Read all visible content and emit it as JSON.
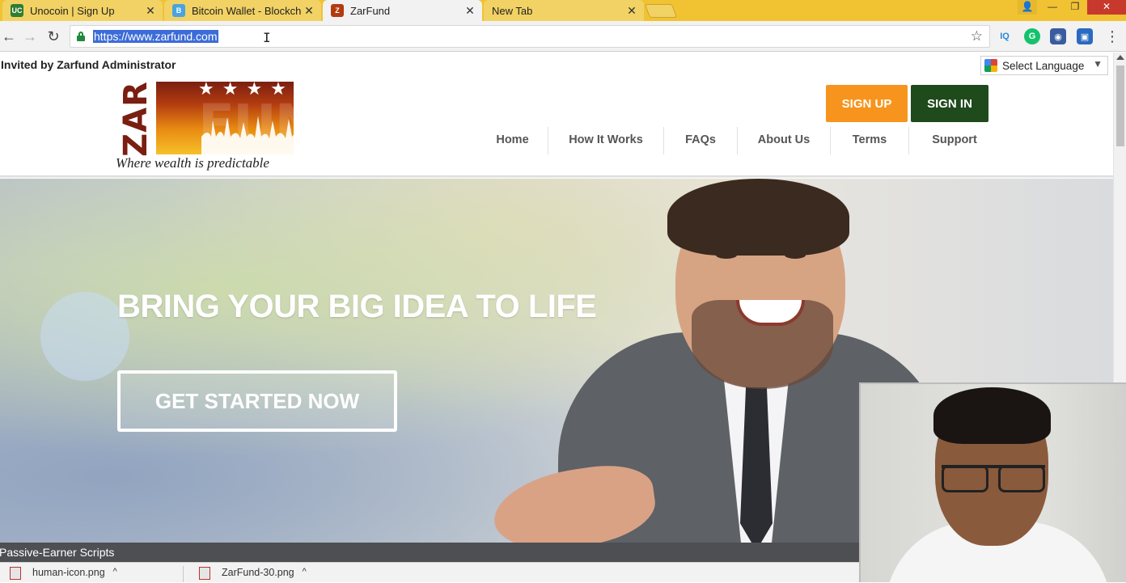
{
  "tabs": [
    {
      "label": "Unocoin | Sign Up",
      "favicon_text": "UC",
      "favicon_color": "#2e7d32",
      "close": "✕"
    },
    {
      "label": "Bitcoin Wallet - Blockcha",
      "favicon_text": "B",
      "favicon_color": "#4aa3df",
      "close": "✕"
    },
    {
      "label": "ZarFund",
      "favicon_text": "Z",
      "favicon_color": "#b23b10",
      "close": "✕"
    },
    {
      "label": "New Tab",
      "favicon_text": "",
      "favicon_color": "",
      "close": "✕"
    }
  ],
  "window_controls": {
    "minimize": "—",
    "maximize": "❐",
    "close": "✕",
    "profile": "👤"
  },
  "toolbar": {
    "back": "←",
    "forward": "→",
    "reload": "↻",
    "url": "https://www.zarfund.com",
    "star": "☆",
    "extensions": [
      {
        "name": "iq-extension-icon",
        "text": "IQ",
        "color": "#2a86d8"
      },
      {
        "name": "grammarly-icon",
        "text": "G",
        "color": "#15c26b"
      },
      {
        "name": "user-ext-icon",
        "text": "◉",
        "color": "#3a5ba0"
      },
      {
        "name": "save-ext-icon",
        "text": "▣",
        "color": "#2a6ac0"
      }
    ],
    "menu": "⋮"
  },
  "page": {
    "invited_text": "Invited by Zarfund Administrator",
    "language_selector": {
      "label": "Select Language",
      "arrow": "▼"
    },
    "logo": {
      "left_text": "ZAR",
      "right_text": "FUND",
      "stars": "★★★★★",
      "tagline": "Where wealth is predictable"
    },
    "buttons": {
      "signup": "SIGN UP",
      "signin": "SIGN IN"
    },
    "colors": {
      "signup": "#f7941d",
      "signin": "#1f4a1c"
    },
    "nav": [
      "Home",
      "How It Works",
      "FAQs",
      "About Us",
      "Terms",
      "Support"
    ],
    "hero": {
      "title": "BRING YOUR BIG IDEA TO LIFE",
      "cta": "GET STARTED NOW"
    },
    "bottom_bar_text": "Passive-Earner Scripts"
  },
  "downloads": [
    {
      "label": "human-icon.png",
      "caret": "^"
    },
    {
      "label": "ZarFund-30.png",
      "caret": "^"
    }
  ]
}
